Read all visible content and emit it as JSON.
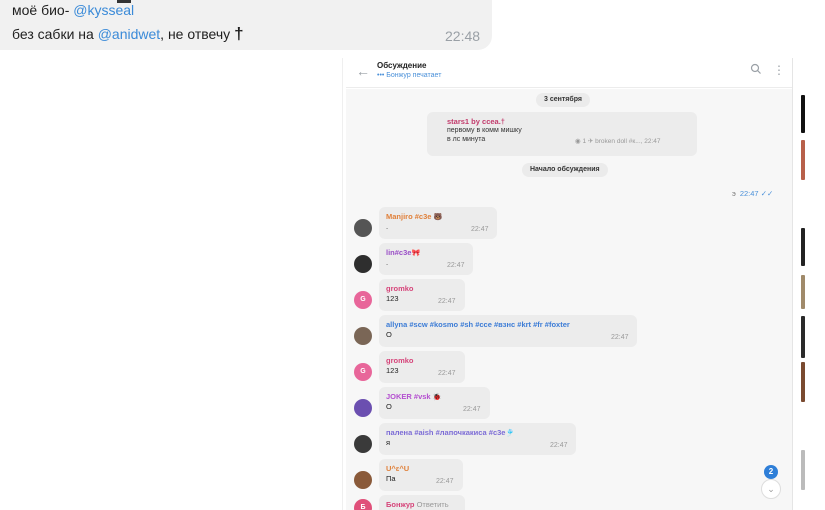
{
  "outer_message": {
    "line1_prefix": "моё био- ",
    "line1_mention": "@kysseal",
    "line2_prefix": "без сабки на ",
    "line2_mention": "@anidwet",
    "line2_suffix": ", не отвечу",
    "cross": "†",
    "time": "22:48"
  },
  "header": {
    "title": "Обсуждение",
    "subtitle": "••• Бонжур печатает"
  },
  "chat": {
    "date_chip": "3 сентября",
    "pinned": {
      "title": "stars1 by ccea.†",
      "line1": "первому в комм мишку",
      "line2": "в лс минута",
      "meta": "◉ 1  ✈ broken doll #к..., 22:47"
    },
    "start_chip": "Начало обсуждения",
    "own_message": {
      "number": "э",
      "time": "22:47",
      "checks": "✓✓"
    },
    "messages": [
      {
        "avatar_letter": "",
        "sender": "Manjiro #c3e",
        "emoji": "🐻",
        "text": ".",
        "time": "22:47",
        "sender_color": "#e0803a",
        "avatar_color": "#555555"
      },
      {
        "avatar_letter": "",
        "sender": "lin#c3e",
        "emoji": "🎀",
        "text": ".",
        "time": "22:47",
        "sender_color": "#9a4fc7",
        "avatar_color": "#2e2e2e"
      },
      {
        "avatar_letter": "G",
        "sender": "gromko",
        "emoji": "",
        "text": "123",
        "time": "22:47",
        "sender_color": "#d6457a",
        "avatar_color": "#e8669a"
      },
      {
        "avatar_letter": "",
        "sender": "allyna #scw #kosmo #sh #cce #взнс #krt #fr #foxter",
        "emoji": "",
        "text": "О",
        "time": "22:47",
        "sender_color": "#3c7cd6",
        "avatar_color": "#7a6656"
      },
      {
        "avatar_letter": "G",
        "sender": "gromko",
        "emoji": "",
        "text": "123",
        "time": "22:47",
        "sender_color": "#d6457a",
        "avatar_color": "#e8669a"
      },
      {
        "avatar_letter": "",
        "sender": "JOKER #vsk",
        "emoji": "🐞",
        "text": "О",
        "time": "22:47",
        "sender_color": "#b44fd0",
        "avatar_color": "#6b4fb0"
      },
      {
        "avatar_letter": "",
        "sender": "палена #aish #лапочкакиса #c3e",
        "emoji": "🎐",
        "text": "я",
        "time": "22:47",
        "sender_color": "#7c6cd6",
        "avatar_color": "#3a3a3a"
      },
      {
        "avatar_letter": "",
        "sender": "U^ε^U",
        "emoji": "",
        "text": "Па",
        "time": "22:47",
        "sender_color": "#e0803a",
        "avatar_color": "#8a5a3a"
      },
      {
        "avatar_letter": "Б",
        "sender": "Бонжур",
        "emoji": "",
        "text": "Ответить",
        "time": "",
        "sender_color": "#d6457a",
        "avatar_color": "#e0507a"
      }
    ],
    "unread_badge": "2",
    "scroll_down_icon": "chevron-down-icon"
  },
  "colors": {
    "accent": "#2f7fd8",
    "mention": "#3a8ad8",
    "bubble": "#ececec"
  }
}
